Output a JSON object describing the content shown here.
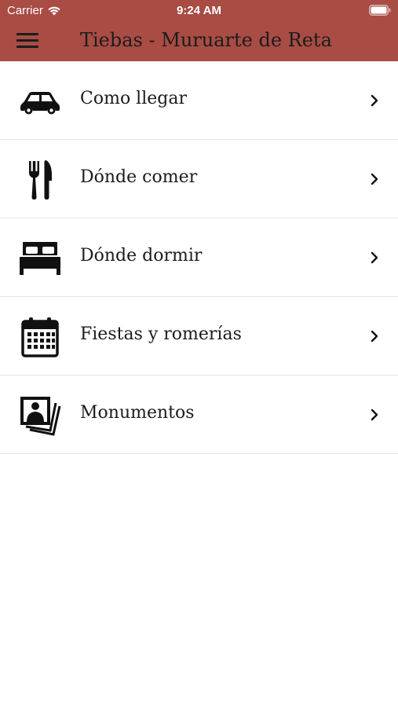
{
  "status_bar": {
    "carrier": "Carrier",
    "time": "9:24 AM"
  },
  "nav": {
    "title": "Tiebas - Muruarte de Reta",
    "menu_icon": "hamburger-menu-icon"
  },
  "colors": {
    "header_background": "#a84c44",
    "text": "#1c1c1c",
    "divider": "#e6e6e6"
  },
  "menu": {
    "items": [
      {
        "label": "Como llegar",
        "icon": "car-icon"
      },
      {
        "label": "Dónde comer",
        "icon": "fork-knife-icon"
      },
      {
        "label": "Dónde dormir",
        "icon": "bed-icon"
      },
      {
        "label": "Fiestas y romerías",
        "icon": "calendar-icon"
      },
      {
        "label": "Monumentos",
        "icon": "photos-icon"
      }
    ]
  }
}
